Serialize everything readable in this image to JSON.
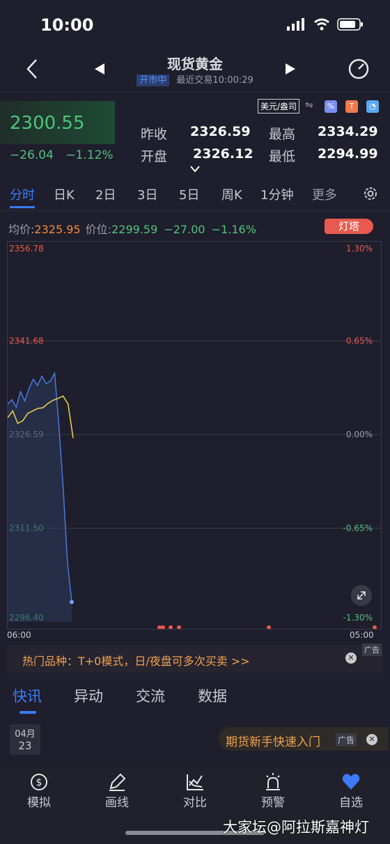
{
  "status": {
    "time": "10:00"
  },
  "header": {
    "title": "现货黄金",
    "market_status": "开市中",
    "last_trade": "最近交易10:00:29"
  },
  "quote": {
    "price": "2300.55",
    "change": "−26.04",
    "change_pct": "−1.12%",
    "currency_unit": "美元/盎司",
    "prev_close_label": "昨收",
    "prev_close": "2326.59",
    "high_label": "最高",
    "high": "2334.29",
    "open_label": "开盘",
    "open": "2326.12",
    "low_label": "最低",
    "low": "2294.99"
  },
  "period_tabs": [
    "分时",
    "日K",
    "2日",
    "3日",
    "5日",
    "周K",
    "1分钟",
    "更多"
  ],
  "info": {
    "avg_label": "均价:",
    "avg_value": "2325.95",
    "price_label": "价位:",
    "price_value": "2299.59",
    "diff": "−27.00",
    "diff_pct": "−1.16%",
    "tower": "灯塔"
  },
  "chart_data": {
    "type": "line",
    "ylabels_left": [
      "2356.78",
      "2341.68",
      "2326.59",
      "2311.50",
      "2296.40"
    ],
    "ylabels_right": [
      "1.30%",
      "0.65%",
      "0.00%",
      "-0.65%",
      "-1.30%"
    ],
    "ylim": [
      2296.4,
      2356.78
    ],
    "x_start": "06:00",
    "x_end": "05:00",
    "series": [
      {
        "values": [
          2331.5,
          2332.2,
          2331.0,
          2333.5,
          2332.0,
          2334.0,
          2335.5,
          2334.5,
          2336.0,
          2334.8,
          2335.2,
          2336.5,
          2328.0,
          2318.0,
          2306.0,
          2299.6
        ]
      },
      {
        "values": [
          2329.3,
          2330.4,
          2328.4,
          2328.8,
          2330.0,
          2330.4,
          2330.8,
          2330.9,
          2331.6,
          2332.1,
          2332.4,
          2332.8,
          2331.5,
          2326.0
        ]
      }
    ],
    "colors": {
      "price_line": "#4a78e0",
      "avg_line": "#f3d34a",
      "up": "#e85a4f",
      "down": "#4fc47c",
      "flat": "#9c9ba8"
    }
  },
  "ad": {
    "text": "热门品种：T+0模式，日/夜盘可多次买卖 >>",
    "tag": "广告"
  },
  "news_tabs": [
    "快讯",
    "异动",
    "交流",
    "数据"
  ],
  "news": {
    "month": "04月",
    "day": "23",
    "promo": "期货新手快速入门",
    "promo_tag": "广告"
  },
  "bottom_nav": [
    {
      "label": "模拟",
      "icon": "dollar-icon"
    },
    {
      "label": "画线",
      "icon": "pen-icon"
    },
    {
      "label": "对比",
      "icon": "compare-icon"
    },
    {
      "label": "预警",
      "icon": "alarm-icon"
    },
    {
      "label": "自选",
      "icon": "heart-icon"
    }
  ],
  "watermark": "大家坛@阿拉斯嘉神灯"
}
